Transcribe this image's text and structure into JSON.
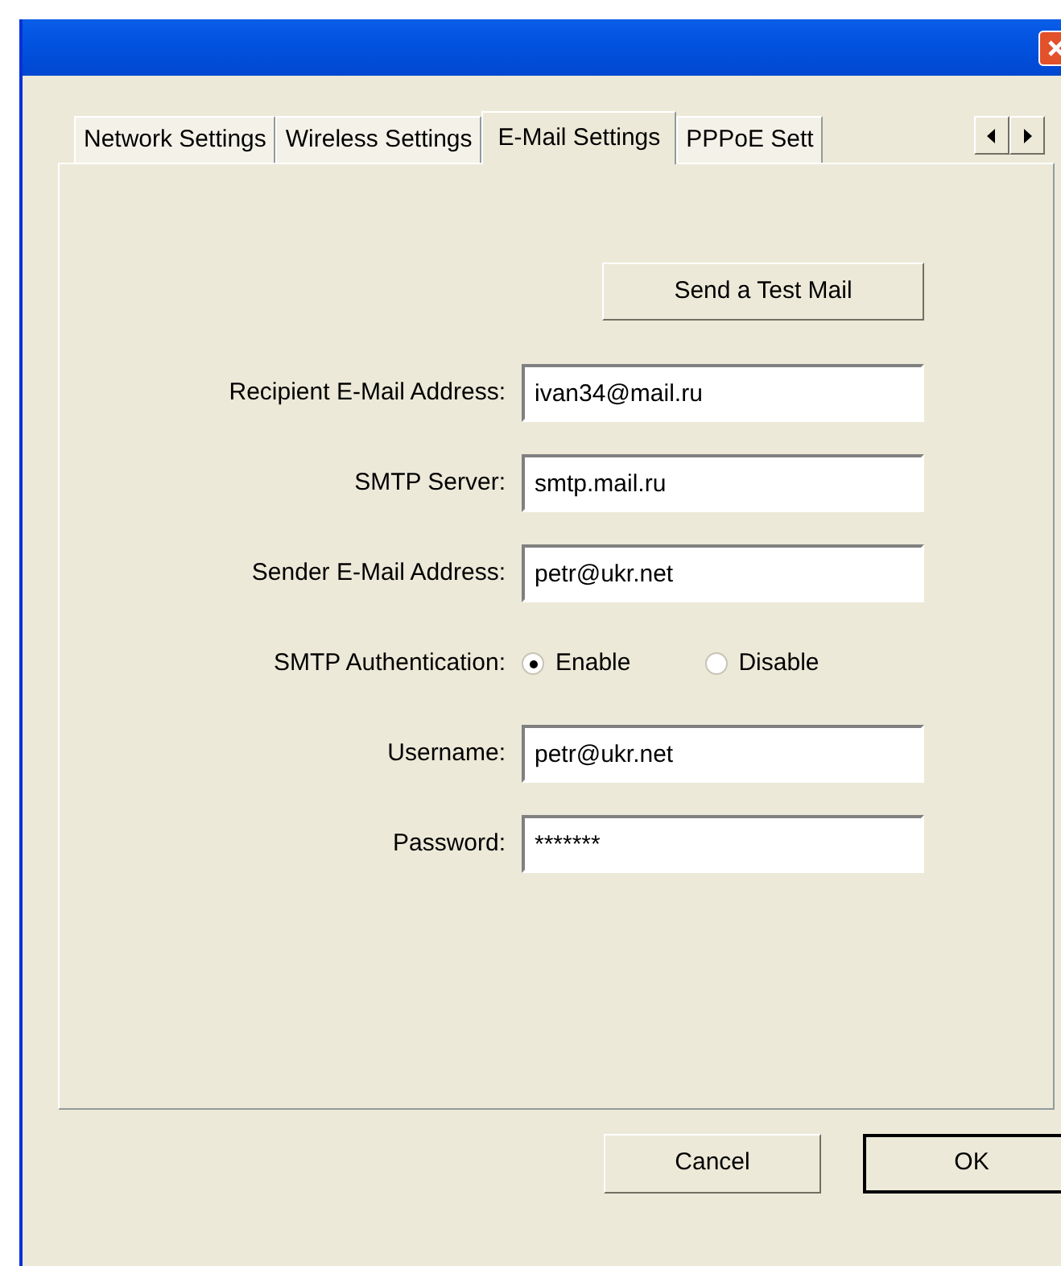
{
  "tabs": [
    {
      "label": "Network Settings",
      "selected": false
    },
    {
      "label": "Wireless Settings",
      "selected": false
    },
    {
      "label": "E-Mail Settings",
      "selected": true
    },
    {
      "label": "PPPoE Sett",
      "selected": false
    }
  ],
  "test_button": "Send a Test Mail",
  "fields": [
    {
      "kind": "text",
      "label": "Recipient E-Mail Address:",
      "value": "ivan34@mail.ru"
    },
    {
      "kind": "text",
      "label": "SMTP Server:",
      "value": "smtp.mail.ru"
    },
    {
      "kind": "text",
      "label": "Sender E-Mail Address:",
      "value": "petr@ukr.net"
    },
    {
      "kind": "radio",
      "label": "SMTP Authentication:",
      "options": [
        {
          "label": "Enable",
          "selected": true
        },
        {
          "label": "Disable",
          "selected": false
        }
      ]
    },
    {
      "kind": "text",
      "label": "Username:",
      "value": "petr@ukr.net"
    },
    {
      "kind": "text",
      "label": "Password:",
      "value": "*******"
    }
  ],
  "buttons": [
    {
      "label": "Cancel",
      "default": false
    },
    {
      "label": "OK",
      "default": true
    }
  ]
}
